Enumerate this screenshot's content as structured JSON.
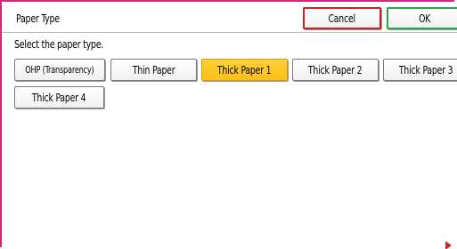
{
  "header": {
    "title": "Paper Type",
    "cancel_label": "Cancel",
    "ok_label": "OK"
  },
  "main": {
    "prompt": "Select the paper type.",
    "paper_types": [
      {
        "label": "OHP (Transparency)",
        "selected": false
      },
      {
        "label": "Thin Paper",
        "selected": false
      },
      {
        "label": "Thick Paper 1",
        "selected": true
      },
      {
        "label": "Thick Paper 2",
        "selected": false
      },
      {
        "label": "Thick Paper 3",
        "selected": false
      },
      {
        "label": "Thick Paper 4",
        "selected": false
      }
    ]
  },
  "colors": {
    "frame_border": "#d02a7c",
    "cancel_border": "#d02020",
    "ok_border": "#29a84a",
    "selected_fill": "#ffc727"
  }
}
